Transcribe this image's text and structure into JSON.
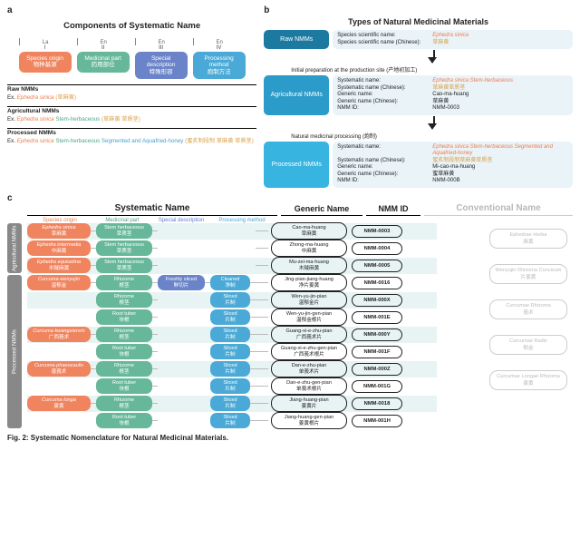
{
  "labels": {
    "a": "a",
    "b": "b",
    "c": "c"
  },
  "panelA": {
    "title": "Components of Systematic Name",
    "langs": [
      "La",
      "En",
      "En",
      "En"
    ],
    "nums": [
      "I",
      "II",
      "III",
      "IV"
    ],
    "comps": [
      {
        "en": "Species origin",
        "cn": "物种基源"
      },
      {
        "en": "Medicinal part",
        "cn": "药用部位"
      },
      {
        "en": "Special description",
        "cn": "特殊形容"
      },
      {
        "en": "Processing method",
        "cn": "炮制方法"
      }
    ],
    "stages": [
      {
        "name": "Raw NMMs",
        "ex_pre": "Ex. ",
        "sp": "Ephedra sinica",
        "extra_cn": "(草麻黄)"
      },
      {
        "name": "Agricultural NMMs",
        "ex_pre": "Ex. ",
        "sp": "Ephedra sinica",
        "mp": "Stem-herbaceous",
        "extra_cn": "(草麻黄 草质茎)"
      },
      {
        "name": "Processed NMMs",
        "ex_pre": "Ex. ",
        "sp": "Ephedra sinica",
        "mp": "Stem-herbaceous",
        "sd": "Segmented and Aquafried-honey",
        "extra_cn": "(蜜炙制段制 草麻黄 草质茎)"
      }
    ]
  },
  "panelB": {
    "title": "Types of Natural Medicinal Materials",
    "blocks": [
      {
        "head": "Raw NMMs",
        "rows": [
          {
            "k": "Species scientific name:",
            "v": "Ephedra sinica",
            "cls": "t-or"
          },
          {
            "k": "Species scientific name (Chinese):",
            "v": "草麻黄",
            "cls": "t-ocn"
          }
        ]
      },
      {
        "arrow": "Initial preparation at the production site (产地初加工)"
      },
      {
        "head": "Agricultural NMMs",
        "rows": [
          {
            "k": "Systematic name:",
            "v": "Ephedra sinica Stem-herbaceous",
            "cls": "t-or"
          },
          {
            "k": "Systematic name (Chinese):",
            "v": "草麻黄草质茎",
            "cls": "t-ocn"
          },
          {
            "k": "Generic name:",
            "v": "Cao-ma-huang",
            "cls": ""
          },
          {
            "k": "Generic name (Chinese):",
            "v": "草麻黄",
            "cls": ""
          },
          {
            "k": "NMM ID:",
            "v": "NMM-0003",
            "cls": ""
          }
        ]
      },
      {
        "arrow": "Natural medicinal processing (炮制)"
      },
      {
        "head": "Processed NMMs",
        "rows": [
          {
            "k": "Systematic name:",
            "v": "Ephedra sinica Stem-herbaceous Segmented and Aquafried-honey",
            "cls": "t-or",
            "v2": "",
            "multiclass": "t-cy"
          },
          {
            "k": "Systematic name (Chinese):",
            "v": "蜜炙制段制草麻黄草质茎",
            "cls": "t-ocn"
          },
          {
            "k": "Generic name:",
            "v": "Mi-cao-ma-huang",
            "cls": ""
          },
          {
            "k": "Generic name (Chinese):",
            "v": "蜜草麻黄",
            "cls": ""
          },
          {
            "k": "NMM ID:",
            "v": "NMM-000B",
            "cls": ""
          }
        ]
      }
    ]
  },
  "panelC": {
    "headers": {
      "sys": "Systematic Name",
      "gn": "Generic Name",
      "id": "NMM ID",
      "conv": "Conventional Name"
    },
    "subheads": {
      "sp": "Species origin",
      "mp": "Medicinal part",
      "sd": "Special description",
      "pm": "Processing method"
    },
    "groups": [
      {
        "label": "Agricultural NMMs",
        "rows": [
          {
            "sp": {
              "la": "Ephedra sinica",
              "cn": "草麻黄"
            },
            "mp": {
              "en": "Stem herbaceous",
              "cn": "草质茎"
            },
            "gn": {
              "en": "Cao-ma-huang",
              "cn": "草麻黄"
            },
            "id": "NMM-0003"
          },
          {
            "sp": {
              "la": "Ephedra intermedia",
              "cn": "中麻黄"
            },
            "mp": {
              "en": "Stem herbaceous",
              "cn": "草质茎"
            },
            "gn": {
              "en": "Zhong-ma-huang",
              "cn": "中麻黄"
            },
            "id": "NMM-0004"
          },
          {
            "sp": {
              "la": "Ephedra equisetina",
              "cn": "木贼麻黄"
            },
            "mp": {
              "en": "Stem herbaceous",
              "cn": "草质茎"
            },
            "gn": {
              "en": "Mu-zei-ma-huang",
              "cn": "木贼麻黄"
            },
            "id": "NMM-0005"
          }
        ]
      },
      {
        "label": "Processed NMMs",
        "rows": [
          {
            "sp": {
              "la": "Curcuma wenyujin",
              "cn": "温郁金"
            },
            "mp": {
              "en": "Rhizome",
              "cn": "根茎"
            },
            "sd": {
              "en": "Freshly sliced",
              "cn": "鲜切片"
            },
            "pm": {
              "en": "Cleaned",
              "cn": "净制"
            },
            "gn": {
              "en": "Jing-pian-jiang-huang",
              "cn": "净片姜黄"
            },
            "id": "NMM-0016"
          },
          {
            "sp_cont": true,
            "mp": {
              "en": "Rhizome",
              "cn": "根茎"
            },
            "pm": {
              "en": "Sliced",
              "cn": "片制"
            },
            "gn": {
              "en": "Wen-yu-jin-pian",
              "cn": "温郁金片"
            },
            "id": "NMM-000X"
          },
          {
            "sp_cont": true,
            "mp": {
              "en": "Root tuber",
              "cn": "块根"
            },
            "pm": {
              "en": "Sliced",
              "cn": "片制"
            },
            "gn": {
              "en": "Wen-yu-jin-gen-pian",
              "cn": "温郁金根片"
            },
            "id": "NMM-001E"
          },
          {
            "sp": {
              "la": "Curcuma kwangsiensis",
              "cn": "广西莪术"
            },
            "mp": {
              "en": "Rhizome",
              "cn": "根茎"
            },
            "pm": {
              "en": "Sliced",
              "cn": "片制"
            },
            "gn": {
              "en": "Guang-xi-e-zhu-pian",
              "cn": "广西莪术片"
            },
            "id": "NMM-000Y"
          },
          {
            "sp_cont": true,
            "mp": {
              "en": "Root tuber",
              "cn": "块根"
            },
            "pm": {
              "en": "Sliced",
              "cn": "片制"
            },
            "gn": {
              "en": "Guang-xi-e-zhu-gen-pian",
              "cn": "广西莪术根片"
            },
            "id": "NMM-001F"
          },
          {
            "sp": {
              "la": "Curcuma phaeocaulis",
              "cn": "蓬莪术"
            },
            "mp": {
              "en": "Rhizome",
              "cn": "根茎"
            },
            "pm": {
              "en": "Sliced",
              "cn": "片制"
            },
            "gn": {
              "en": "Dan-e-zhu-pian",
              "cn": "单莪术片"
            },
            "id": "NMM-000Z"
          },
          {
            "sp_cont": true,
            "mp": {
              "en": "Root tuber",
              "cn": "块根"
            },
            "pm": {
              "en": "Sliced",
              "cn": "片制"
            },
            "gn": {
              "en": "Dan-e-zhu-gen-pian",
              "cn": "单莪术根片"
            },
            "id": "NMM-001G"
          },
          {
            "sp": {
              "la": "Curcuma longa",
              "cn": "姜黄"
            },
            "mp": {
              "en": "Rhizome",
              "cn": "根茎"
            },
            "pm": {
              "en": "Sliced",
              "cn": "片制"
            },
            "gn": {
              "en": "Jiang-huang-pian",
              "cn": "姜黄片"
            },
            "id": "NMM-0018"
          },
          {
            "sp_cont": true,
            "mp": {
              "en": "Root tuber",
              "cn": "块根"
            },
            "pm": {
              "en": "Sliced",
              "cn": "片制"
            },
            "gn": {
              "en": "Jiang-huang-gen-pian",
              "cn": "姜黄根片"
            },
            "id": "NMM-001H"
          }
        ]
      }
    ],
    "conv": [
      {
        "en": "Ephedrae Herba",
        "cn": "麻黄"
      },
      {
        "en": "Wenyujin Rhizoma Concisum",
        "cn": "片姜黄"
      },
      {
        "en": "Curcumae Rhizoma",
        "cn": "莪术"
      },
      {
        "en": "Curcumae Radix",
        "cn": "郁金"
      },
      {
        "en": "Curcumae Longae Rhizoma",
        "cn": "姜黄"
      }
    ]
  },
  "caption": "Fig. 2: Systematic Nomenclature for Natural Medicinal Materials."
}
